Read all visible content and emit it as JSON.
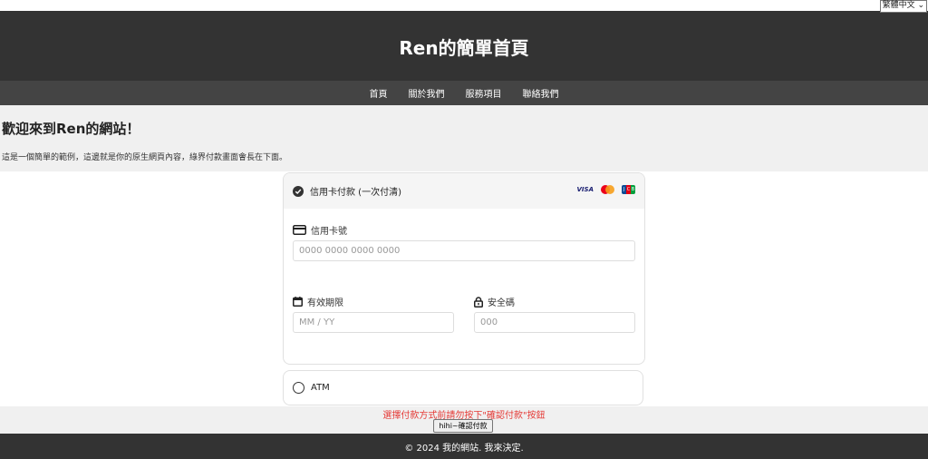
{
  "language": {
    "selected": "繁體中文"
  },
  "header": {
    "title": "Ren的簡單首頁"
  },
  "nav": {
    "items": [
      "首頁",
      "關於我們",
      "服務項目",
      "聯絡我們"
    ]
  },
  "main": {
    "heading": "歡迎來到Ren的網站！",
    "intro": "這是一個簡單的範例，這邊就是你的原生網頁內容，綠界付款畫面會長在下面。"
  },
  "payment": {
    "credit": {
      "label": "信用卡付款 (一次付清)",
      "brands": [
        "VISA",
        "Mastercard",
        "JCB"
      ],
      "card_number_label": "信用卡號",
      "card_number_placeholder": "0000 0000 0000 0000",
      "expiry_label": "有效期限",
      "expiry_placeholder": "MM / YY",
      "cvc_label": "安全碼",
      "cvc_placeholder": "000"
    },
    "atm": {
      "label": "ATM"
    }
  },
  "warning": "選擇付款方式前請勿按下\"確認付款\"按鈕",
  "confirm_button": "hihi~確認付款",
  "footer": {
    "text": "© 2024 我的網站. 我來決定."
  }
}
